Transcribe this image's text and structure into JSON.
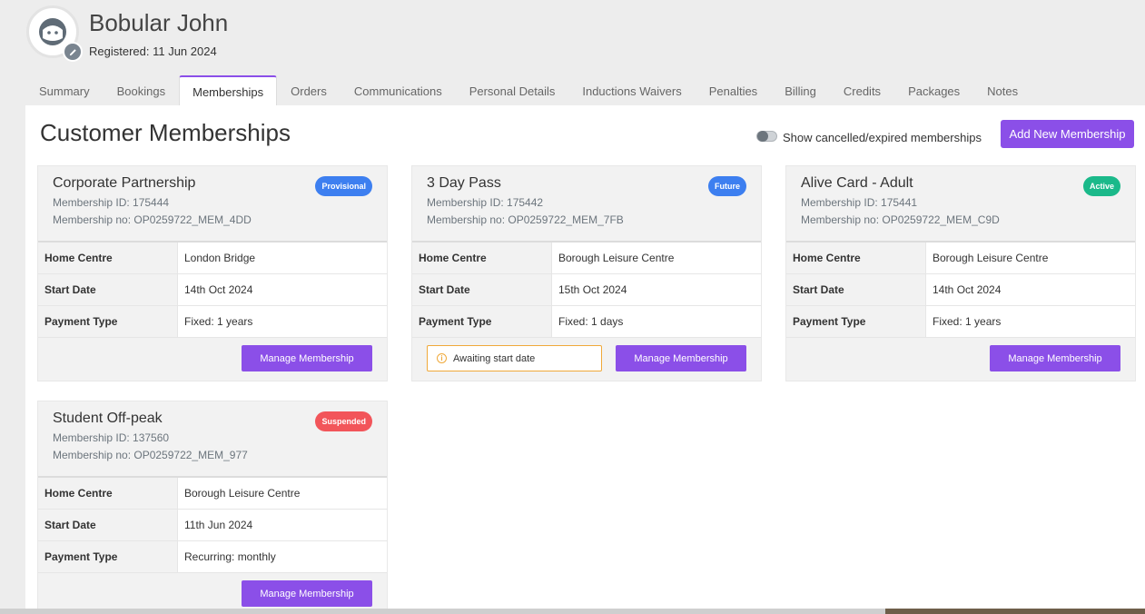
{
  "customer": {
    "name": "Bobular John",
    "registered": "Registered: 11 Jun 2024"
  },
  "tabs": [
    {
      "label": "Summary"
    },
    {
      "label": "Bookings"
    },
    {
      "label": "Memberships",
      "active": true
    },
    {
      "label": "Orders"
    },
    {
      "label": "Communications"
    },
    {
      "label": "Personal Details"
    },
    {
      "label": "Inductions Waivers"
    },
    {
      "label": "Penalties"
    },
    {
      "label": "Billing"
    },
    {
      "label": "Credits"
    },
    {
      "label": "Packages"
    },
    {
      "label": "Notes"
    }
  ],
  "page": {
    "title": "Customer Memberships",
    "toggle_label": "Show cancelled/expired memberships",
    "toggle_on": false,
    "add_button": "Add New Membership"
  },
  "field_labels": {
    "home_centre": "Home Centre",
    "start_date": "Start Date",
    "payment_type": "Payment Type"
  },
  "memberships": [
    {
      "title": "Corporate Partnership",
      "id_text": "Membership ID: 175444",
      "no_text": "Membership no: OP0259722_MEM_4DD",
      "status": "Provisional",
      "status_color": "#3d7ff0",
      "home_centre": "London Bridge",
      "start_date": "14th Oct 2024",
      "payment_type": "Fixed: 1 years",
      "notice": "",
      "button": "Manage Membership"
    },
    {
      "title": "3 Day Pass",
      "id_text": "Membership ID: 175442",
      "no_text": "Membership no: OP0259722_MEM_7FB",
      "status": "Future",
      "status_color": "#3d7ff0",
      "home_centre": "Borough Leisure Centre",
      "start_date": "15th Oct 2024",
      "payment_type": "Fixed: 1 days",
      "notice": "Awaiting start date",
      "button": "Manage Membership"
    },
    {
      "title": "Alive Card - Adult",
      "id_text": "Membership ID: 175441",
      "no_text": "Membership no: OP0259722_MEM_C9D",
      "status": "Active",
      "status_color": "#1bb98a",
      "home_centre": "Borough Leisure Centre",
      "start_date": "14th Oct 2024",
      "payment_type": "Fixed: 1 years",
      "notice": "",
      "button": "Manage Membership"
    },
    {
      "title": "Student Off-peak",
      "id_text": "Membership ID: 137560",
      "no_text": "Membership no: OP0259722_MEM_977",
      "status": "Suspended",
      "status_color": "#f2555a",
      "home_centre": "Borough Leisure Centre",
      "start_date": "11th Jun 2024",
      "payment_type": "Recurring: monthly",
      "notice": "",
      "button": "Manage Membership"
    }
  ],
  "colors": {
    "accent": "#8b4fe8",
    "notice_border": "#f0a93a"
  },
  "icons": {
    "avatar": "user-face-icon",
    "edit": "pencil-icon",
    "notice": "info-circle-icon"
  }
}
